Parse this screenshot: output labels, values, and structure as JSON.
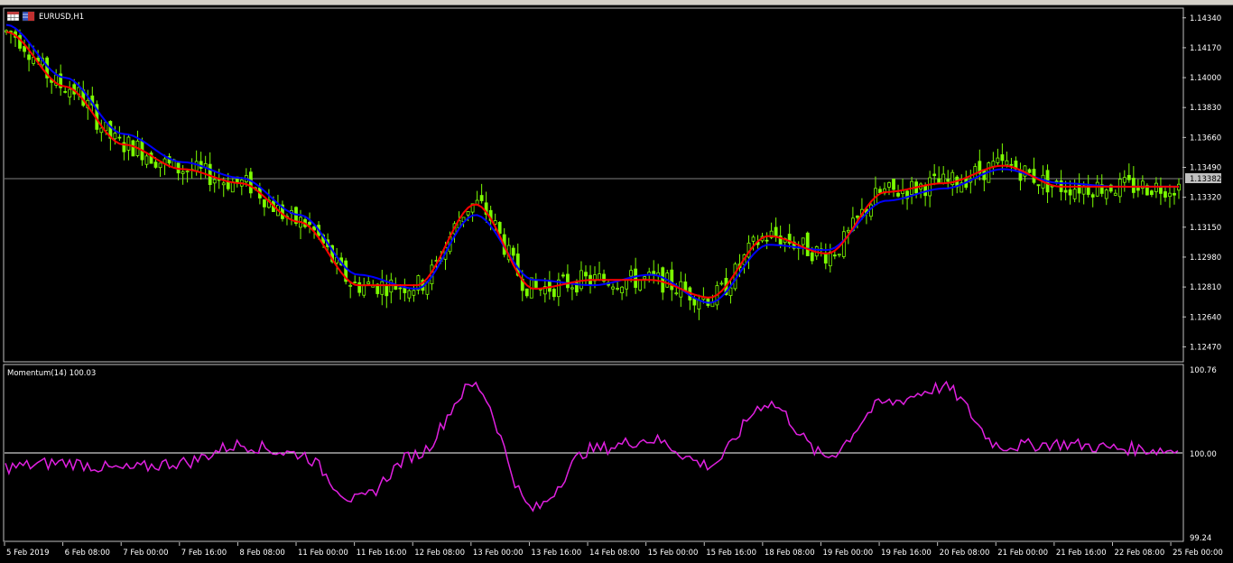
{
  "window": {
    "symbol_title": "EURUSD,H1"
  },
  "price_panel": {
    "current_price": "1.13382",
    "y_ticks": [
      "1.14340",
      "1.14170",
      "1.14000",
      "1.13830",
      "1.13660",
      "1.13490",
      "1.13320",
      "1.13150",
      "1.12980",
      "1.12810",
      "1.12640",
      "1.12470"
    ],
    "ma_fast_color": "#ff0000",
    "ma_slow_color": "#0000ff",
    "candle_color": "#7cfc00"
  },
  "indicator_panel": {
    "title": "Momentum(14) 100.03",
    "y_ticks": [
      "100.76",
      "100.00",
      "99.24"
    ],
    "line_color": "#e020e0"
  },
  "x_axis": {
    "ticks": [
      "5 Feb 2019",
      "6 Feb 08:00",
      "7 Feb 00:00",
      "7 Feb 16:00",
      "8 Feb 08:00",
      "11 Feb 00:00",
      "11 Feb 16:00",
      "12 Feb 08:00",
      "13 Feb 00:00",
      "13 Feb 16:00",
      "14 Feb 08:00",
      "15 Feb 00:00",
      "15 Feb 16:00",
      "18 Feb 08:00",
      "19 Feb 00:00",
      "19 Feb 16:00",
      "20 Feb 08:00",
      "21 Feb 00:00",
      "21 Feb 16:00",
      "22 Feb 08:00",
      "25 Feb 00:00"
    ]
  },
  "chart_data": {
    "type": "line",
    "title": "EURUSD,H1",
    "x": [
      "5 Feb 2019",
      "6 Feb 08:00",
      "7 Feb 00:00",
      "7 Feb 16:00",
      "8 Feb 08:00",
      "11 Feb 00:00",
      "11 Feb 16:00",
      "12 Feb 08:00",
      "13 Feb 00:00",
      "13 Feb 16:00",
      "14 Feb 08:00",
      "15 Feb 00:00",
      "15 Feb 16:00",
      "18 Feb 08:00",
      "19 Feb 00:00",
      "19 Feb 16:00",
      "20 Feb 08:00",
      "21 Feb 00:00",
      "21 Feb 16:00",
      "22 Feb 08:00",
      "25 Feb 00:00"
    ],
    "ylim": [
      1.1239,
      1.1439
    ],
    "series": [
      {
        "values": [
          1.1426,
          1.1395,
          1.1362,
          1.1348,
          1.134,
          1.1318,
          1.1282,
          1.1282,
          1.1328,
          1.128,
          1.1285,
          1.1285,
          1.1275,
          1.131,
          1.13,
          1.1335,
          1.134,
          1.135,
          1.1338,
          1.1338,
          1.1338
        ]
      },
      {
        "values": [
          1.143,
          1.14,
          1.1368,
          1.1352,
          1.1343,
          1.1322,
          1.1288,
          1.128,
          1.1322,
          1.1285,
          1.1282,
          1.1288,
          1.1272,
          1.1305,
          1.1302,
          1.133,
          1.1337,
          1.1348,
          1.134,
          1.1338,
          1.1338
        ]
      }
    ],
    "momentum": {
      "ylim": [
        99.24,
        100.76
      ],
      "values": [
        99.88,
        99.92,
        99.86,
        99.92,
        100.08,
        100.0,
        99.58,
        99.99,
        100.62,
        99.5,
        100.04,
        100.13,
        99.9,
        100.46,
        99.98,
        100.46,
        100.6,
        100.07,
        100.09,
        100.05,
        100.03
      ]
    }
  }
}
